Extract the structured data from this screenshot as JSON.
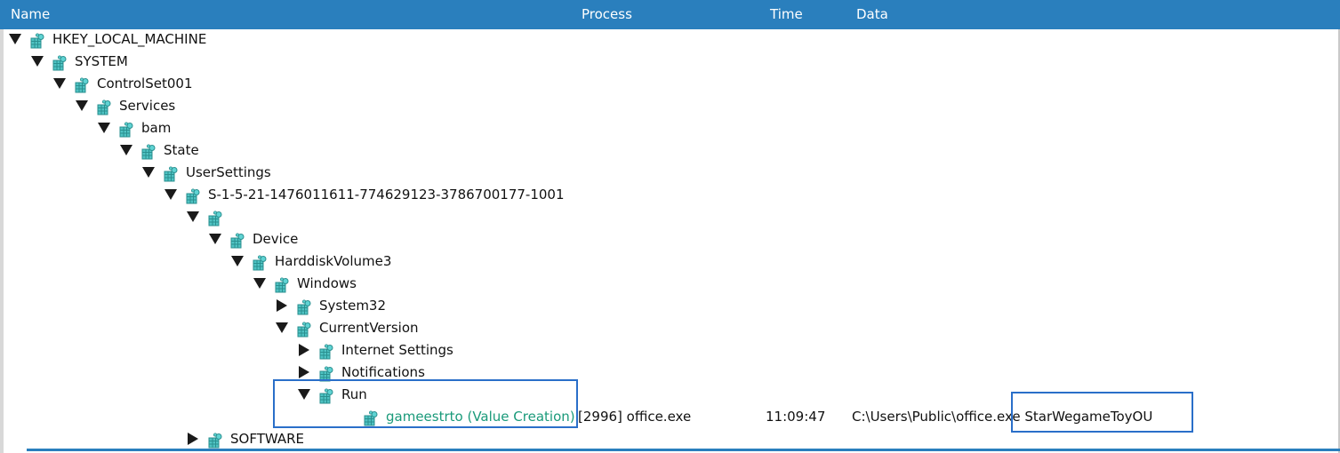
{
  "columns": {
    "name": "Name",
    "process": "Process",
    "time": "Time",
    "data": "Data"
  },
  "tree": [
    {
      "label": "HKEY_LOCAL_MACHINE",
      "toggle": "expanded"
    },
    {
      "label": "SYSTEM",
      "toggle": "expanded"
    },
    {
      "label": "ControlSet001",
      "toggle": "expanded"
    },
    {
      "label": "Services",
      "toggle": "expanded"
    },
    {
      "label": "bam",
      "toggle": "expanded"
    },
    {
      "label": "State",
      "toggle": "expanded"
    },
    {
      "label": "UserSettings",
      "toggle": "expanded"
    },
    {
      "label": "S-1-5-21-1476011611-774629123-3786700177-1001",
      "toggle": "expanded"
    },
    {
      "label": "",
      "toggle": "expanded"
    },
    {
      "label": "Device",
      "toggle": "expanded"
    },
    {
      "label": "HarddiskVolume3",
      "toggle": "expanded"
    },
    {
      "label": "Windows",
      "toggle": "expanded"
    },
    {
      "label": "System32",
      "toggle": "collapsed"
    },
    {
      "label": "CurrentVersion",
      "toggle": "expanded"
    },
    {
      "label": "Internet Settings",
      "toggle": "collapsed"
    },
    {
      "label": "Notifications",
      "toggle": "collapsed"
    },
    {
      "label": "Run",
      "toggle": "expanded"
    },
    {
      "label": "gameestrto (Value Creation)",
      "toggle": "none",
      "process": "[2996] office.exe",
      "time": "11:09:47",
      "data": "C:\\Users\\Public\\office.exe StarWegameToyOU"
    },
    {
      "label": "SOFTWARE",
      "toggle": "collapsed"
    }
  ],
  "colors": {
    "header": "#2a7fbd",
    "value_text": "#1a9a7a",
    "highlight": "#2a6fc9"
  }
}
